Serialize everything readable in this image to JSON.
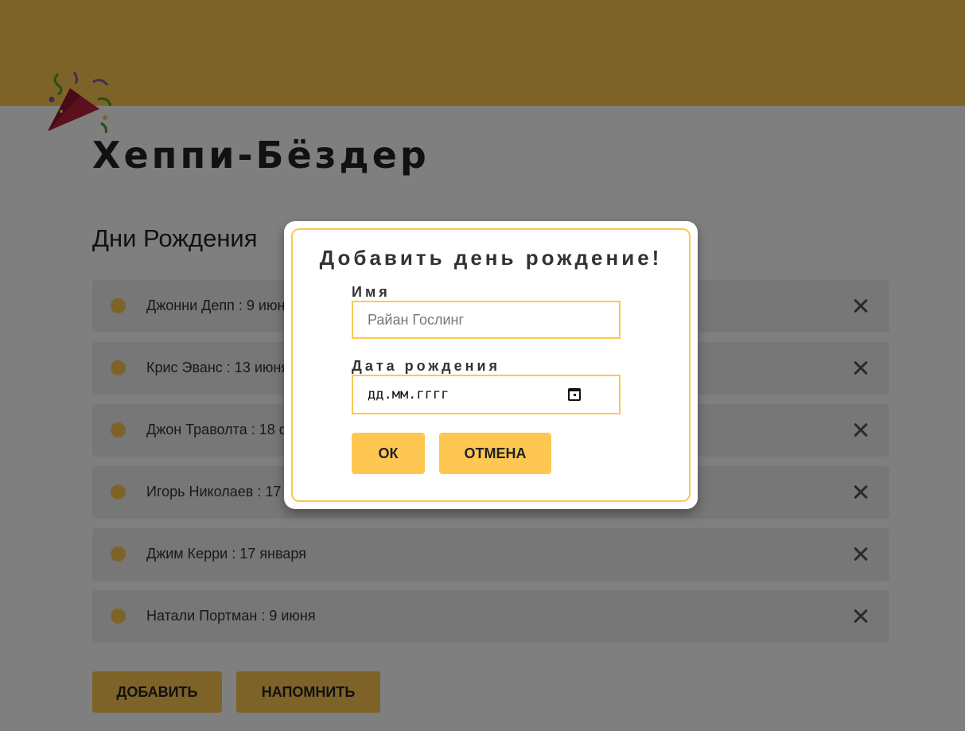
{
  "app": {
    "title": "Хеппи-Бёздер",
    "logo_icon": "party-popper-icon"
  },
  "section": {
    "title": "Дни Рождения"
  },
  "birthdays": [
    {
      "label": "Джонни Депп : 9 июня"
    },
    {
      "label": "Крис Эванс : 13 июня"
    },
    {
      "label": "Джон Траволта : 18 февраля"
    },
    {
      "label": "Игорь Николаев : 17 января"
    },
    {
      "label": "Джим Керри : 17 января"
    },
    {
      "label": "Натали Портман : 9 июня"
    }
  ],
  "actions": {
    "add_label": "ДОБАВИТЬ",
    "remind_label": "НАПОМНИТЬ"
  },
  "modal": {
    "title": "Добавить день рождение!",
    "name_label": "Имя",
    "name_placeholder": "Райан Гослинг",
    "date_label": "Дата рождения",
    "date_placeholder": "дд.мм.гггг",
    "ok_label": "ОК",
    "cancel_label": "ОТМЕНА"
  },
  "colors": {
    "accent": "#fdc751",
    "text": "#222222",
    "row_bg": "#efefef",
    "overlay": "rgba(0,0,0,0.5)"
  }
}
